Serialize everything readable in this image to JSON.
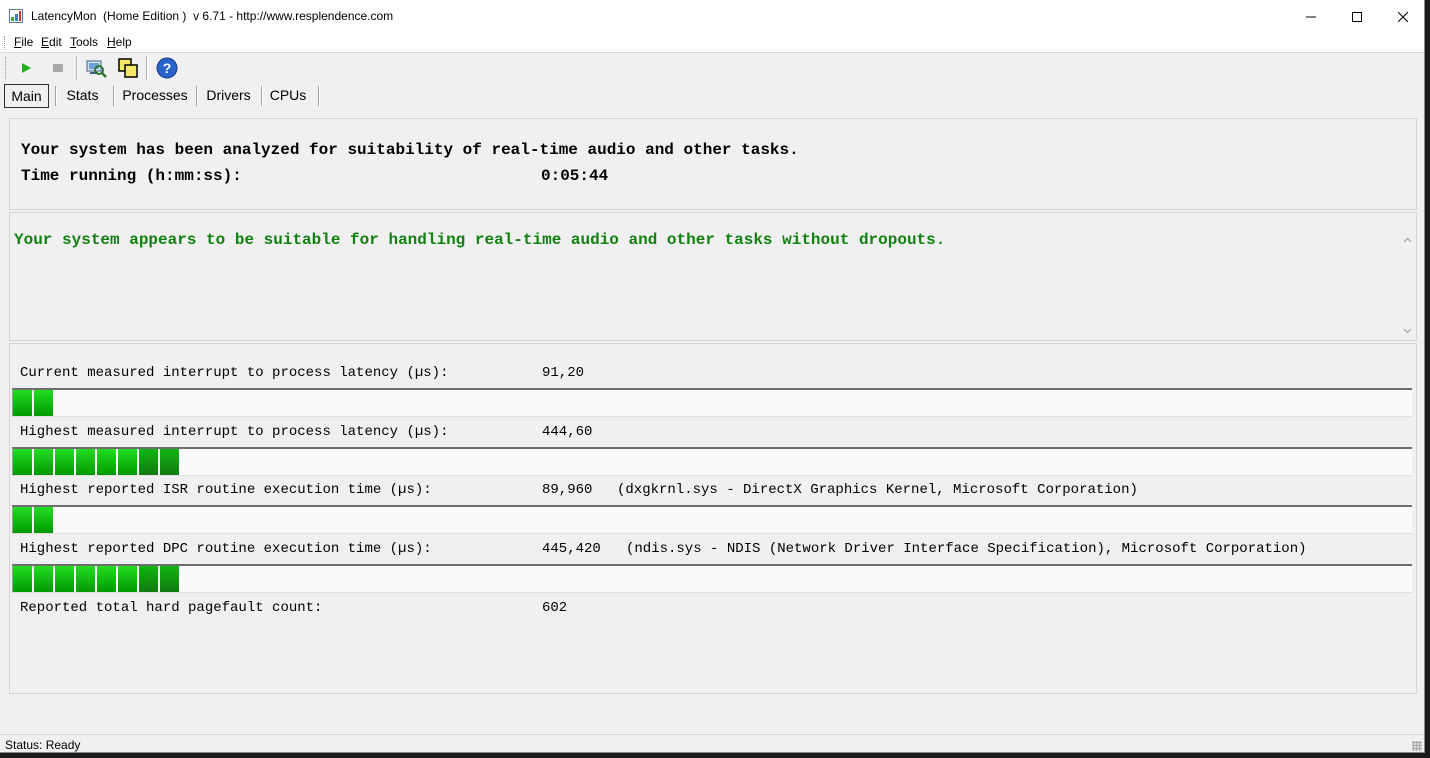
{
  "window": {
    "title": "LatencyMon  (Home Edition )  v 6.71 - http://www.resplendence.com"
  },
  "menu": [
    {
      "key": "F",
      "rest": "ile"
    },
    {
      "key": "E",
      "rest": "dit"
    },
    {
      "key": "T",
      "rest": "ools"
    },
    {
      "key": "H",
      "rest": "elp"
    }
  ],
  "toolbar": {
    "icons": [
      "play-icon",
      "stop-icon",
      "analyze-icon",
      "windows-icon",
      "help-icon"
    ]
  },
  "tabs": [
    "Main",
    "Stats",
    "Processes",
    "Drivers",
    "CPUs"
  ],
  "summary": {
    "line1": "Your system has been analyzed for suitability of real-time audio and other tasks.",
    "time_label": "Time running (h:mm:ss):",
    "time_value": "0:05:44"
  },
  "verdict": {
    "text": "Your system appears to be suitable for handling real-time audio and other tasks without dropouts.",
    "color": "#108010"
  },
  "metrics": [
    {
      "label": "Current measured interrupt to process latency (µs):",
      "value": "91,20",
      "extra": "",
      "bar_segments": 2
    },
    {
      "label": "Highest measured interrupt to process latency (µs):",
      "value": "444,60",
      "extra": "",
      "bar_segments": 8
    },
    {
      "label": "Highest reported ISR routine execution time (µs):",
      "value": "89,960",
      "extra": "(dxgkrnl.sys - DirectX Graphics Kernel, Microsoft Corporation)",
      "bar_segments": 2
    },
    {
      "label": "Highest reported DPC routine execution time (µs):",
      "value": "445,420",
      "extra": "(ndis.sys - NDIS (Network Driver Interface Specification), Microsoft Corporation)",
      "bar_segments": 8
    },
    {
      "label": "Reported total hard pagefault count:",
      "value": "602",
      "extra": ""
    }
  ],
  "status": {
    "text": "Status: Ready"
  },
  "colors": {
    "bar_green": "#22dd22",
    "bar_dark_green": "#117a11",
    "verdict_green": "#108010"
  }
}
